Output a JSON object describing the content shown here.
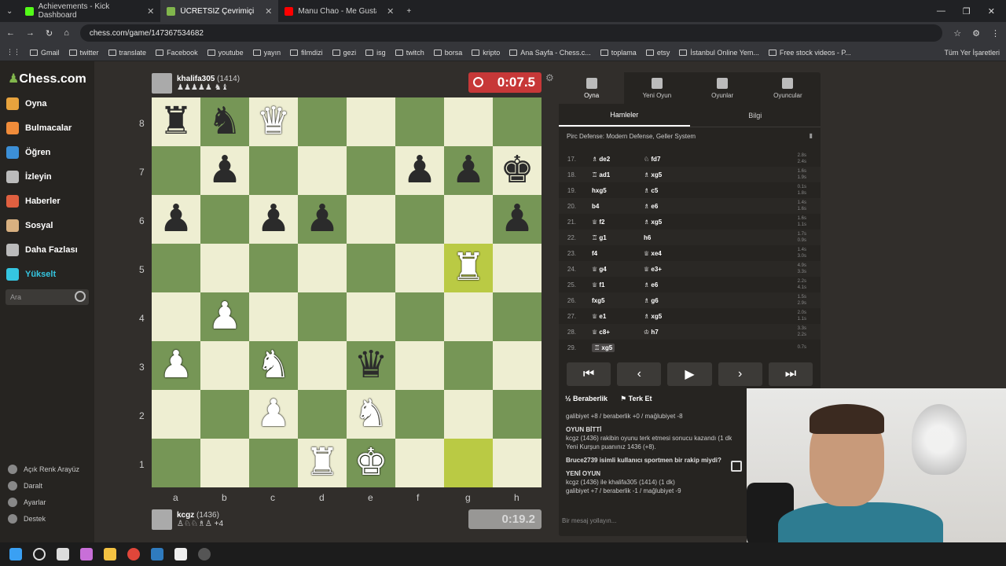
{
  "browser": {
    "tabs": [
      {
        "title": "Achievements - Kick Dashboard",
        "color": "#53fc18",
        "active": false
      },
      {
        "title": "ÜCRETSİZ Çevrimiçi Satranç",
        "color": "#81b64c",
        "active": true
      },
      {
        "title": "Manu Chao - Me Gustas Tu",
        "color": "#ff0000",
        "active": false
      }
    ],
    "url": "chess.com/game/147367534682",
    "bookmarks": [
      "Gmail",
      "twitter",
      "translate",
      "Facebook",
      "youtube",
      "yayın",
      "filmdizi",
      "gezi",
      "isg",
      "twitch",
      "borsa",
      "kripto",
      "Ana Sayfa - Chess.c...",
      "toplama",
      "etsy",
      "İstanbul Online Yem...",
      "Free stock videos - P..."
    ],
    "bookmarks_right": "Tüm Yer İşaretleri"
  },
  "sidebar": {
    "logo": "Chess.com",
    "items": [
      {
        "label": "Oyna",
        "color": "#e8a33d"
      },
      {
        "label": "Bulmacalar",
        "color": "#f08c3a"
      },
      {
        "label": "Öğren",
        "color": "#3c8fd6"
      },
      {
        "label": "İzleyin",
        "color": "#bbbbbb"
      },
      {
        "label": "Haberler",
        "color": "#e06040"
      },
      {
        "label": "Sosyal",
        "color": "#d8b080"
      },
      {
        "label": "Daha Fazlası",
        "color": "#bbbbbb"
      },
      {
        "label": "Yükselt",
        "color": "#35c5e0"
      }
    ],
    "search_placeholder": "Ara",
    "footer": [
      "Açık Renk Arayüz",
      "Daralt",
      "Ayarlar",
      "Destek"
    ]
  },
  "top_player": {
    "name": "khalifa305",
    "rating": "(1414)",
    "captured": "♟♟♟♟♟ ♞♝",
    "clock": "0:07.5"
  },
  "bottom_player": {
    "name": "kcgz",
    "rating": "(1436)",
    "captured": "♙♘♘♗♙ +4",
    "clock": "0:19.2"
  },
  "board": {
    "ranks": [
      "8",
      "7",
      "6",
      "5",
      "4",
      "3",
      "2",
      "1"
    ],
    "files": [
      "a",
      "b",
      "c",
      "d",
      "e",
      "f",
      "g",
      "h"
    ],
    "rows": [
      [
        "bR",
        "bN",
        "wQ",
        "",
        "",
        "",
        "",
        ""
      ],
      [
        "",
        "bP",
        "",
        "",
        "",
        "bP",
        "bP",
        "bK"
      ],
      [
        "bP",
        "",
        "bP",
        "bP",
        "",
        "",
        "",
        "bP"
      ],
      [
        "",
        "",
        "",
        "",
        "",
        "",
        "wR",
        ""
      ],
      [
        "",
        "wP",
        "",
        "",
        "",
        "",
        "",
        ""
      ],
      [
        "wP",
        "",
        "wN",
        "",
        "bQ",
        "",
        "",
        ""
      ],
      [
        "",
        "",
        "wP",
        "",
        "wN",
        "",
        "",
        ""
      ],
      [
        "",
        "",
        "",
        "wR",
        "wK",
        "",
        "",
        ""
      ]
    ],
    "highlight": [
      "g5",
      "g1"
    ]
  },
  "panel": {
    "tabs": [
      "Oyna",
      "Yeni Oyun",
      "Oyunlar",
      "Oyuncular"
    ],
    "subtabs": [
      "Hamleler",
      "Bilgi"
    ],
    "opening": "Pirc Defense: Modern Defense, Geller System",
    "moves": [
      {
        "n": "17.",
        "w": "♗ de2",
        "b": "♘ fd7",
        "tw": "2.8s",
        "tb": "2.4s"
      },
      {
        "n": "18.",
        "w": "♖ ad1",
        "b": "♗ xg5",
        "tw": "1.6s",
        "tb": "1.9s"
      },
      {
        "n": "19.",
        "w": "hxg5",
        "b": "♗ c5",
        "tw": "0.1s",
        "tb": "1.8s"
      },
      {
        "n": "20.",
        "w": "b4",
        "b": "♗ e6",
        "tw": "1.4s",
        "tb": "1.6s"
      },
      {
        "n": "21.",
        "w": "♕ f2",
        "b": "♗ xg5",
        "tw": "1.6s",
        "tb": "1.1s"
      },
      {
        "n": "22.",
        "w": "♖ g1",
        "b": "h6",
        "tw": "1.7s",
        "tb": "0.9s"
      },
      {
        "n": "23.",
        "w": "f4",
        "b": "♕ xe4",
        "tw": "1.4s",
        "tb": "3.0s"
      },
      {
        "n": "24.",
        "w": "♕ g4",
        "b": "♕ e3+",
        "tw": "4.9s",
        "tb": "3.3s"
      },
      {
        "n": "25.",
        "w": "♕ f1",
        "b": "♗ e6",
        "tw": "2.2s",
        "tb": "4.1s"
      },
      {
        "n": "26.",
        "w": "fxg5",
        "b": "♗ g6",
        "tw": "1.5s",
        "tb": "2.9s"
      },
      {
        "n": "27.",
        "w": "♕ e1",
        "b": "♗ xg5",
        "tw": "2.0s",
        "tb": "1.1s"
      },
      {
        "n": "28.",
        "w": "♕ c8+",
        "b": "♔ h7",
        "tw": "3.3s",
        "tb": "2.2s"
      },
      {
        "n": "29.",
        "w": "♖ xg5",
        "b": "",
        "tw": "0.7s",
        "tb": ""
      }
    ],
    "nav": [
      "⏮",
      "‹",
      "▶",
      "›",
      "⏭"
    ],
    "draw_label": "Beraberlik",
    "resign_label": "Terk Et",
    "chat": {
      "line1": "galibiyet +8 / beraberlik +0 / mağlubiyet -8",
      "heading1": "OYUN BİTTİ",
      "line2": "kcgz (1436) rakibin oyunu terk etmesi sonucu kazandı (1 dk",
      "line3": "Yeni Kurşun puanınız 1436 (+8).",
      "line4": "Bruce2739 isimli kullanıcı sportmen bir rakip miydi?",
      "heading2": "YENİ OYUN",
      "line5": "kcgz (1436) ile khalifa305 (1414) (1 dk)",
      "line6": "galibiyet +7 / beraberlik -1 / mağlubiyet -9"
    },
    "message_placeholder": "Bir mesaj yollayın..."
  },
  "colors": {
    "light": "#eeeed2",
    "dark": "#769656",
    "highlight": "#baca44"
  }
}
